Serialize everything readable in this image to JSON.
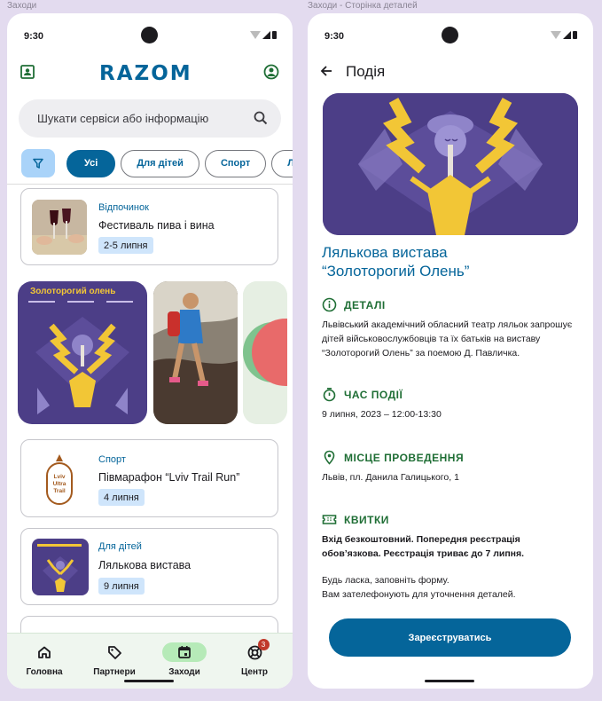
{
  "frames": {
    "left_label": "Заходи",
    "right_label": "Заходи - Сторінка деталей"
  },
  "status": {
    "time": "9:30"
  },
  "list_screen": {
    "logo": "RAZOM",
    "search_placeholder": "Шукати сервіси або інформацію",
    "chips": [
      "Усі",
      "Для дітей",
      "Спорт",
      "Л"
    ],
    "events": [
      {
        "category": "Відпочинок",
        "title": "Фестиваль пива і вина",
        "date": "2-5 липня"
      },
      {
        "category": "Спорт",
        "title": "Півмарафон “Lviv Trail Run”",
        "date": "4 липня"
      },
      {
        "category": "Для дітей",
        "title": "Лялькова вистава",
        "date": "9 липня"
      }
    ],
    "poster_title": "Золоторогий олень",
    "trail_logo_text": "Lviv Ultra Trail",
    "nav": [
      {
        "label": "Головна",
        "icon": "home-icon"
      },
      {
        "label": "Партнери",
        "icon": "tag-icon"
      },
      {
        "label": "Заходи",
        "icon": "calendar-icon"
      },
      {
        "label": "Центр",
        "icon": "support-icon",
        "badge": "3"
      }
    ]
  },
  "detail_screen": {
    "header_title": "Подія",
    "event_title_line1": "Лялькова вистава",
    "event_title_line2": "“Золоторогий Олень”",
    "details": {
      "heading": "ДЕТАЛІ",
      "text": "Львівський академічний обласний театр ляльок запрошує дітей військовослужбовців та їх батьків на виставу “Золоторогий Олень” за поемою Д. Павличка."
    },
    "time": {
      "heading": "ЧАС ПОДІЇ",
      "text": "9 липня, 2023 – 12:00-13:30"
    },
    "place": {
      "heading": "МІСЦЕ ПРОВЕДЕННЯ",
      "text": "Львів, пл. Данила Галицького, 1"
    },
    "tickets": {
      "heading": "КВИТКИ",
      "bold_text": "Вхід безкоштовний. Попередня реєстрація обов’язкова. Реєстрація триває до 7 липня.",
      "text_line1": "Будь ласка, заповніть форму.",
      "text_line2": "Вам зателефонують для уточнення деталей."
    },
    "register_button": "Зареєструватись"
  },
  "colors": {
    "brand_blue": "#05659a",
    "accent_green": "#1f6e35",
    "nav_bg": "#eff6ef",
    "poster_purple": "#4c3e87",
    "poster_gold": "#f2c636"
  }
}
